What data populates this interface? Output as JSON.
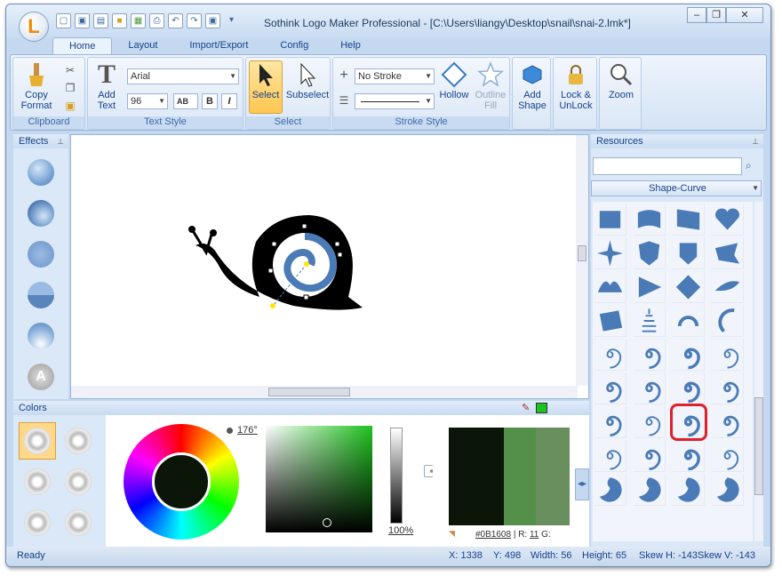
{
  "window": {
    "title": "Sothink Logo Maker Professional - [C:\\Users\\liangy\\Desktop\\snail\\snai-2.lmk*]",
    "logo_letter": "L"
  },
  "quick_access": [
    "new-icon",
    "save-icon",
    "open-icon",
    "folder-icon",
    "export-icon",
    "print-icon",
    "undo-icon",
    "redo-icon",
    "save-as-icon",
    "dropdown-icon"
  ],
  "tabs": [
    {
      "label": "Home",
      "active": true
    },
    {
      "label": "Layout"
    },
    {
      "label": "Import/Export"
    },
    {
      "label": "Config"
    },
    {
      "label": "Help"
    }
  ],
  "ribbon": {
    "clipboard": {
      "label": "Clipboard",
      "copy_format": "Copy Format"
    },
    "text_style": {
      "label": "Text Style",
      "add_text": "Add Text",
      "font": "Arial",
      "size": "96",
      "bold": "B",
      "italic": "I",
      "ab": "AB"
    },
    "select": {
      "label": "Select",
      "select": "Select",
      "subselect": "Subselect"
    },
    "stroke_style": {
      "label": "Stroke Style",
      "stroke": "No Stroke",
      "hollow": "Hollow",
      "outline_fill": "Outline Fill"
    },
    "add_shape": "Add Shape",
    "lock": "Lock & UnLock",
    "zoom": "Zoom"
  },
  "effects": {
    "title": "Effects"
  },
  "resources": {
    "title": "Resources",
    "search_placeholder": "",
    "category": "Shape-Curve"
  },
  "colors": {
    "title": "Colors",
    "hue": "176°",
    "brightness_percent": "100",
    "percent_sign": "%",
    "hex": "#0B1608",
    "r_label": "R:",
    "r_value": "11",
    "g_label": "G:",
    "swatch_old": "#0b1608",
    "swatch_mid": "#55904a",
    "swatch_new": "#6a8f5f",
    "indicator": "#1ec21e"
  },
  "status": {
    "ready": "Ready",
    "x": "X: 1338",
    "y": "Y: 498",
    "width": "Width: 56",
    "height": "Height: 65",
    "skew_h": "Skew H: -143",
    "skew_v": "Skew V: -143"
  },
  "colors_accent": {
    "ribbon_blue": "#c4d8f0",
    "shape_blue": "#4a7bb7",
    "highlight_red": "#e0202a"
  }
}
